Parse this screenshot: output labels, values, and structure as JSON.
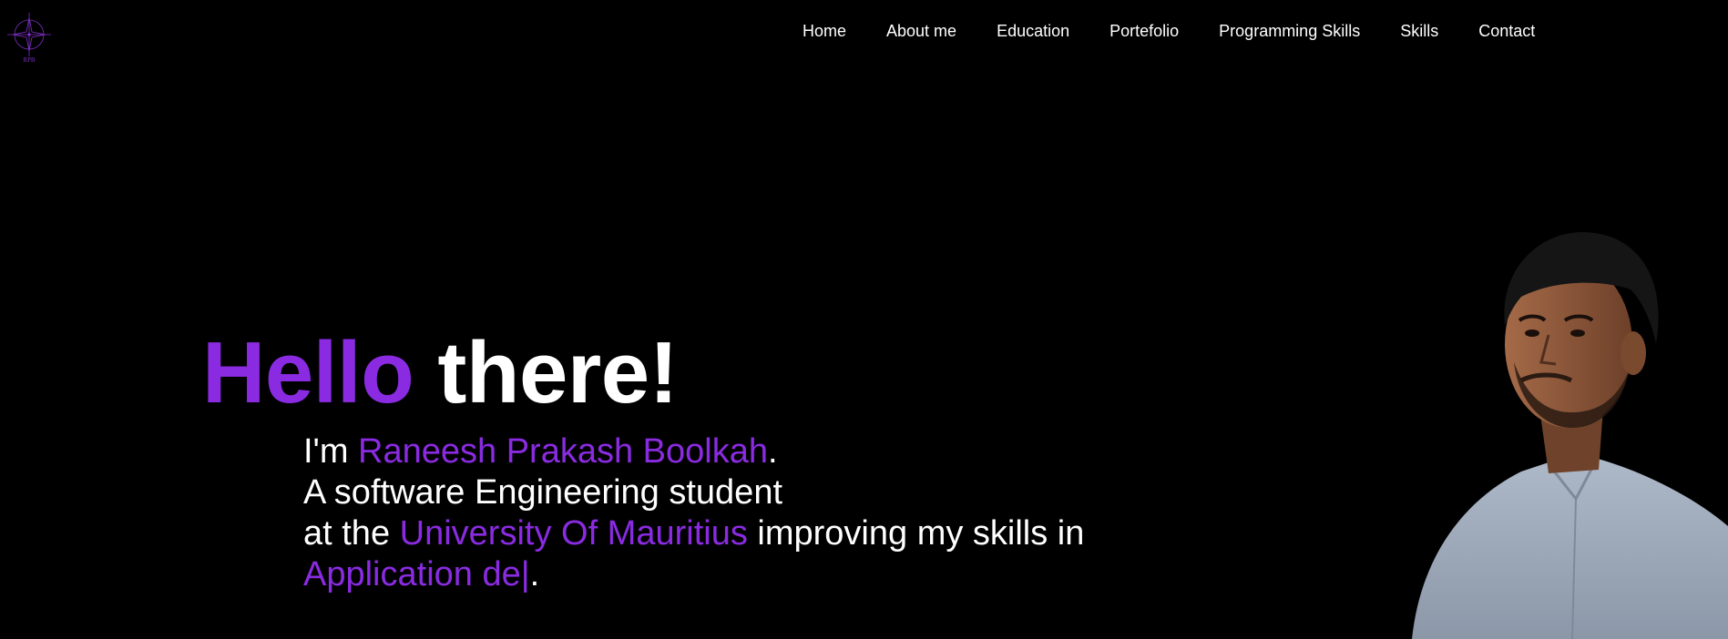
{
  "logo": {
    "caption": "RPB",
    "icon": "compass-star-icon",
    "color": "#8a2be2"
  },
  "nav": {
    "items": [
      {
        "label": "Home"
      },
      {
        "label": "About me"
      },
      {
        "label": "Education"
      },
      {
        "label": "Portefolio"
      },
      {
        "label": "Programming Skills"
      },
      {
        "label": "Skills"
      },
      {
        "label": "Contact"
      }
    ]
  },
  "hero": {
    "greeting_highlight": "Hello",
    "greeting_rest": "there!",
    "intro_prefix": "I'm ",
    "name": "Raneesh Prakash Boolkah",
    "name_suffix": ".",
    "line2": "A software Engineering student",
    "line3_prefix": "at the ",
    "university": "University Of Mauritius",
    "line3_suffix": " improving my skills in",
    "typed_text": "Application de",
    "typed_cursor": "|",
    "typed_suffix": "."
  },
  "portrait": {
    "icon": "profile-photo"
  },
  "colors": {
    "background": "#000000",
    "accent": "#8a2be2",
    "text": "#ffffff"
  }
}
